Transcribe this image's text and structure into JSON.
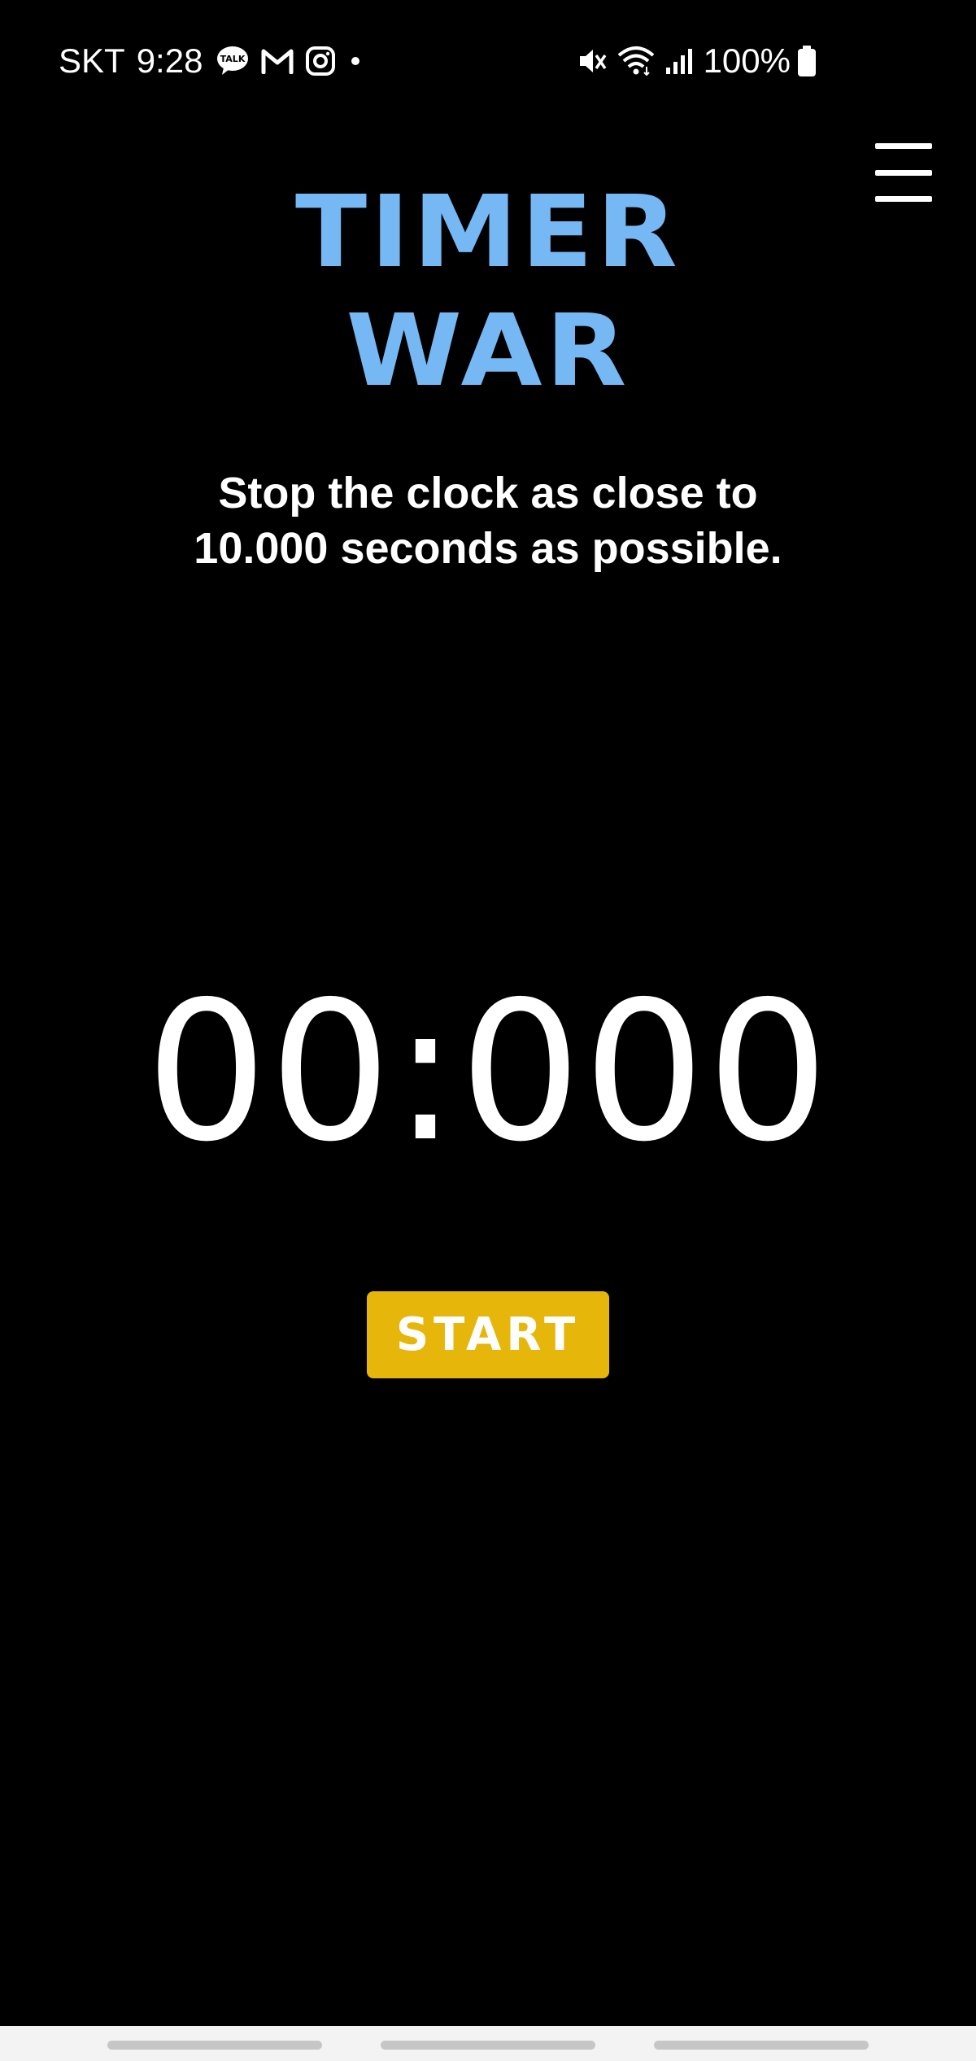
{
  "status_bar": {
    "carrier": "SKT",
    "time": "9:28",
    "left_icons": [
      "kakaotalk-icon",
      "gmail-icon",
      "instagram-icon",
      "dot-icon"
    ],
    "kakaotalk_label": "TALK",
    "right_icons": [
      "mute-icon",
      "wifi-icon",
      "signal-icon",
      "battery-icon"
    ],
    "battery": "100%"
  },
  "menu": {
    "icon": "hamburger-menu-icon"
  },
  "title": {
    "line1": "TIMER",
    "line2": "WAR",
    "color": "#76b8f3"
  },
  "instructions": {
    "line1": "Stop the clock as close to",
    "line2": "10.000 seconds as possible."
  },
  "timer": {
    "value": "00:000"
  },
  "start_button": {
    "label": "START",
    "color": "#e6b60b"
  },
  "colors": {
    "background": "#000000",
    "text": "#ffffff",
    "nav_bar": "#f3f3f3"
  }
}
